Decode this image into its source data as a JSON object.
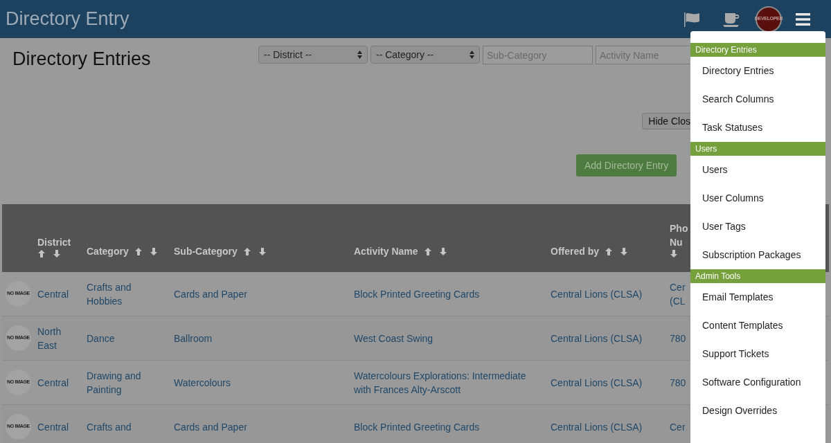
{
  "app_bar": {
    "title": "Directory Entry",
    "avatar_label": "DEVELOPER"
  },
  "page": {
    "title": "Directory Entries"
  },
  "filters": {
    "district": {
      "value": "-- District --"
    },
    "category": {
      "value": "-- Category --"
    },
    "sub_category": {
      "placeholder": "Sub-Category"
    },
    "activity_name": {
      "placeholder": "Activity Name"
    }
  },
  "hide_closed_button": "Hide Clos",
  "add_button": "Add Directory Entry",
  "table": {
    "columns": [
      {
        "label": "District",
        "kind": "sortable"
      },
      {
        "label": "Category",
        "kind": "sortable"
      },
      {
        "label": "Sub-Category",
        "kind": "sortable"
      },
      {
        "label": "Activity Name",
        "kind": "sortable"
      },
      {
        "label": "Offered by",
        "kind": "sortable"
      },
      {
        "label": "Pho Nu",
        "kind": "cut"
      }
    ],
    "rows": [
      {
        "image": "NO IMAGE",
        "cells": [
          "Central",
          "Crafts and Hobbies",
          "Cards and Paper",
          "Block Printed Greeting Cards",
          "Central Lions (CLSA)",
          "Cer (CL"
        ]
      },
      {
        "image": "NO IMAGE",
        "cells": [
          "North East",
          "Dance",
          "Ballroom",
          "West Coast Swing",
          "Central Lions (CLSA)",
          "780"
        ]
      },
      {
        "image": "NO IMAGE",
        "cells": [
          "Central",
          "Drawing and Painting",
          "Watercolours",
          "Watercolours Explorations: Intermediate with Frances Alty-Arscott",
          "Central Lions (CLSA)",
          "780"
        ]
      },
      {
        "image": "NO IMAGE",
        "cells": [
          "Central",
          "Crafts and",
          "Cards and Paper",
          "Block Printed Greeting Cards",
          "Central Lions (CLSA)",
          "Cer"
        ]
      }
    ]
  },
  "menu": {
    "sections": [
      {
        "title": "Directory Entries",
        "items": [
          "Directory Entries",
          "Search Columns",
          "Task Statuses"
        ]
      },
      {
        "title": "Users",
        "items": [
          "Users",
          "User Columns",
          "User Tags",
          "Subscription Packages"
        ]
      },
      {
        "title": "Admin Tools",
        "items": [
          "Email Templates",
          "Content Templates",
          "Support Tickets",
          "Software Configuration",
          "Design Overrides"
        ]
      }
    ]
  }
}
